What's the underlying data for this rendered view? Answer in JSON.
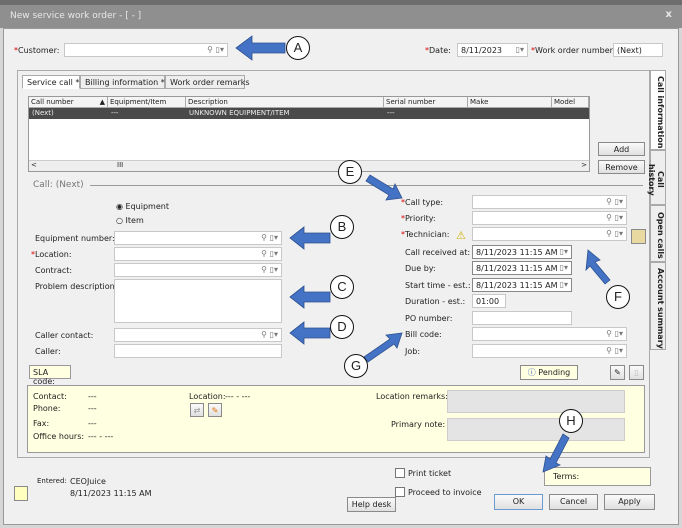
{
  "window": {
    "title": "New service work order - [ - ]",
    "close": "x"
  },
  "header": {
    "customer_label": "Customer:",
    "customer_value": "",
    "date_label": "Date:",
    "date_value": "8/11/2023",
    "won_label": "Work order number:",
    "won_value": "(Next)"
  },
  "tabs": [
    "Service call *",
    "Billing information *",
    "Work order remarks"
  ],
  "side_tabs": [
    "Call information",
    "Call history",
    "Open calls",
    "Account summary"
  ],
  "grid": {
    "columns": [
      "Call number",
      "Equipment/Item",
      "Description",
      "Serial number",
      "Make",
      "Model"
    ],
    "rows": [
      [
        "(Next)",
        "---",
        "UNKNOWN EQUIPMENT/ITEM",
        "---",
        "",
        ""
      ]
    ],
    "scroll_thumb": "III"
  },
  "buttons": {
    "add": "Add",
    "remove": "Remove",
    "pending": "Pending",
    "help_desk": "Help desk",
    "ok": "OK",
    "cancel": "Cancel",
    "apply": "Apply"
  },
  "call": {
    "title": "Call: (Next)",
    "radio_equipment": "Equipment",
    "radio_item": "Item",
    "left": {
      "equipment_number": "Equipment number:",
      "location": "Location:",
      "contract": "Contract:",
      "problem_description": "Problem description:",
      "caller_contact": "Caller contact:",
      "caller": "Caller:"
    },
    "right": {
      "call_type": "Call type:",
      "priority": "Priority:",
      "technician": "Technician:",
      "call_received": "Call received at:",
      "call_received_value": "8/11/2023 11:15 AM",
      "due_by": "Due by:",
      "due_by_value": "8/11/2023 11:15 AM",
      "start_time": "Start time - est.:",
      "start_time_value": "8/11/2023 11:15 AM",
      "duration": "Duration - est.:",
      "duration_value": "01:00",
      "po_number": "PO number:",
      "bill_code": "Bill code:",
      "job": "Job:"
    },
    "sla_code": "SLA code:"
  },
  "info": {
    "contact_label": "Contact:",
    "contact": "---",
    "phone_label": "Phone:",
    "phone": "---",
    "fax_label": "Fax:",
    "fax": "---",
    "office_hours_label": "Office hours:",
    "office_hours": "--- - ---",
    "location_label": "Location:",
    "location": "--- - ---",
    "location_remarks_label": "Location remarks:",
    "primary_note_label": "Primary note:"
  },
  "footer": {
    "entered_label": "Entered:",
    "entered_by": "CEOJuice",
    "entered_at": "8/11/2023 11:15 AM",
    "print_ticket": "Print ticket",
    "proceed_to_invoice": "Proceed to invoice",
    "terms_label": "Terms:"
  },
  "annotations": [
    "A",
    "B",
    "C",
    "D",
    "E",
    "F",
    "G",
    "H"
  ],
  "colors": {
    "arrow": "#4472c4",
    "selected_row": "#4a4a4a",
    "info_bg": "#ffffe1"
  }
}
